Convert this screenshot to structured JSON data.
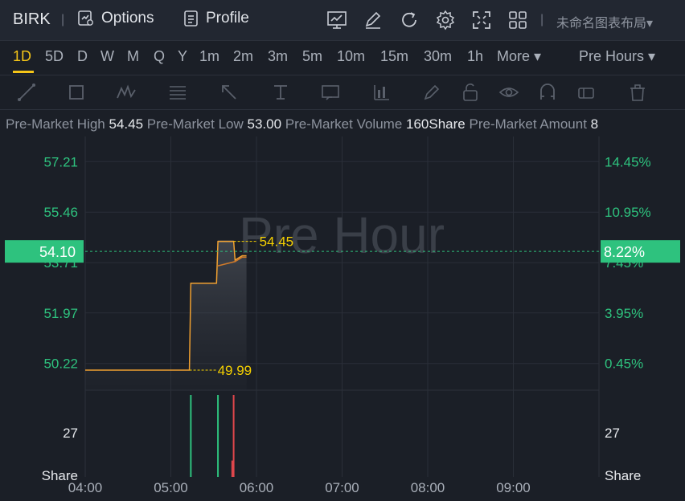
{
  "header": {
    "symbol": "BIRK",
    "options_label": "Options",
    "profile_label": "Profile",
    "layout_name": "未命名图表布局▾"
  },
  "timeframes": [
    "1D",
    "5D",
    "D",
    "W",
    "M",
    "Q",
    "Y",
    "1m",
    "2m",
    "3m",
    "5m",
    "10m",
    "15m",
    "30m",
    "1h",
    "More ▾"
  ],
  "active_timeframe": "1D",
  "session_select": "Pre Hours ▾",
  "info": [
    {
      "label": "Pre-Market High",
      "value": "54.45"
    },
    {
      "label": "Pre-Market Low",
      "value": "53.00"
    },
    {
      "label": "Pre-Market Volume",
      "value": "160Share"
    },
    {
      "label": "Pre-Market Amount",
      "value": "8"
    }
  ],
  "colors": {
    "up": "#2ec27e",
    "down": "#e0474c",
    "line": "#f0a030",
    "marker": "#f5d000"
  },
  "chart_data": {
    "type": "line",
    "watermark": "Pre Hour",
    "x_ticks": [
      "04:00",
      "05:00",
      "06:00",
      "07:00",
      "08:00",
      "09:00"
    ],
    "x_range": [
      "04:00",
      "10:00"
    ],
    "y_ticks": [
      "57.21",
      "55.46",
      "53.71",
      "51.97",
      "50.22"
    ],
    "y_pct_ticks": [
      "14.45%",
      "10.95%",
      "7.45%",
      "3.95%",
      "0.45%"
    ],
    "ylim": [
      49.35,
      58.08
    ],
    "current_price": "54.10",
    "current_pct": "8.22%",
    "high_label": "54.45",
    "low_label": "49.99",
    "price_series": [
      {
        "t": "04:00",
        "v": 49.99
      },
      {
        "t": "05:13",
        "v": 49.99
      },
      {
        "t": "05:14",
        "v": 53.0
      },
      {
        "t": "05:32",
        "v": 53.0
      },
      {
        "t": "05:33",
        "v": 54.45
      },
      {
        "t": "05:44",
        "v": 54.45
      },
      {
        "t": "05:45",
        "v": 53.8
      },
      {
        "t": "05:50",
        "v": 53.95
      },
      {
        "t": "05:53",
        "v": 53.95
      }
    ],
    "avg_series": [
      {
        "t": "05:33",
        "v": 53.6
      },
      {
        "t": "05:45",
        "v": 53.75
      },
      {
        "t": "05:50",
        "v": 53.9
      },
      {
        "t": "05:53",
        "v": 53.9
      }
    ],
    "volume_ticks": [
      "27"
    ],
    "volume_unit": "Share",
    "volume_max": 45,
    "volume_bars": [
      {
        "t": "05:14",
        "v": 45,
        "dir": "up"
      },
      {
        "t": "05:33",
        "v": 45,
        "dir": "up"
      },
      {
        "t": "05:44",
        "v": 45,
        "dir": "down"
      },
      {
        "t": "05:43",
        "v": 9,
        "dir": "down"
      }
    ]
  }
}
